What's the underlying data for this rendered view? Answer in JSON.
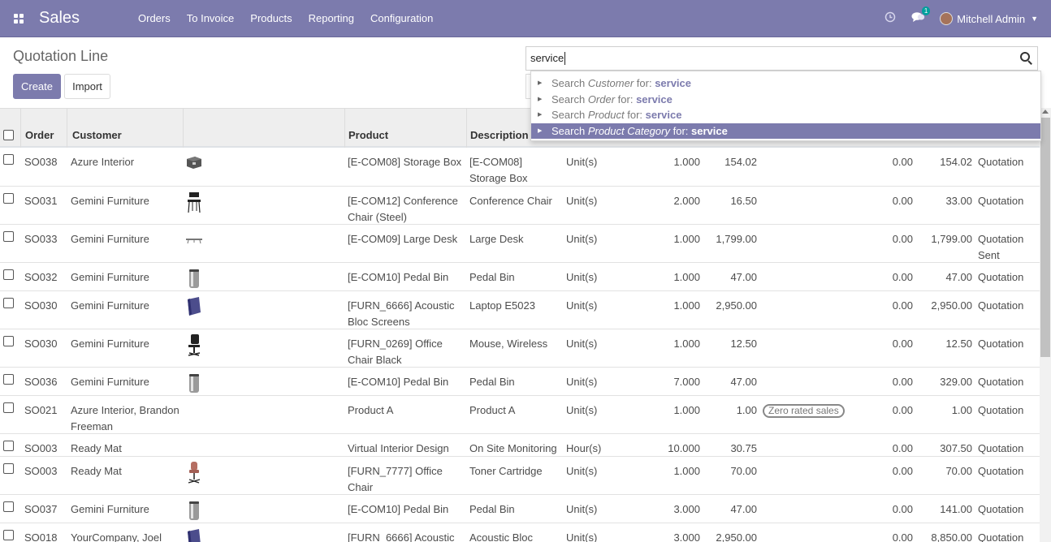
{
  "navbar": {
    "app_name": "Sales",
    "menu": [
      "Orders",
      "To Invoice",
      "Products",
      "Reporting",
      "Configuration"
    ],
    "messages_count": "1",
    "user_name": "Mitchell Admin",
    "colors": {
      "primary": "#7c7bad"
    }
  },
  "control_panel": {
    "title": "Quotation Line",
    "create_label": "Create",
    "import_label": "Import",
    "search_value": "service"
  },
  "autocomplete": [
    {
      "prefix": "Search ",
      "field": "Customer",
      "mid": " for: ",
      "term": "service"
    },
    {
      "prefix": "Search ",
      "field": "Order",
      "mid": " for: ",
      "term": "service"
    },
    {
      "prefix": "Search ",
      "field": "Product",
      "mid": " for: ",
      "term": "service"
    },
    {
      "prefix": "Search ",
      "field": "Product Category",
      "mid": " for: ",
      "term": "service"
    }
  ],
  "table": {
    "headers": {
      "order": "Order",
      "customer": "Customer",
      "product": "Product",
      "description": "Description"
    },
    "rows": [
      {
        "order": "SO038",
        "customer": "Azure Interior",
        "product": "[E-COM08] Storage Box",
        "description": "[E-COM08] Storage Box",
        "uom": "Unit(s)",
        "qty": "1.000",
        "price": "154.02",
        "tax": "",
        "disc": "0.00",
        "subtotal": "154.02",
        "status": "Quotation",
        "image": "box"
      },
      {
        "order": "SO031",
        "customer": "Gemini Furniture",
        "product": "[E-COM12] Conference Chair (Steel)",
        "description": "Conference Chair",
        "uom": "Unit(s)",
        "qty": "2.000",
        "price": "16.50",
        "tax": "",
        "disc": "0.00",
        "subtotal": "33.00",
        "status": "Quotation",
        "image": "chair-steel"
      },
      {
        "order": "SO033",
        "customer": "Gemini Furniture",
        "product": "[E-COM09] Large Desk",
        "description": "Large Desk",
        "uom": "Unit(s)",
        "qty": "1.000",
        "price": "1,799.00",
        "tax": "",
        "disc": "0.00",
        "subtotal": "1,799.00",
        "status": "Quotation Sent",
        "image": "desk"
      },
      {
        "order": "SO032",
        "customer": "Gemini Furniture",
        "product": "[E-COM10] Pedal Bin",
        "description": "Pedal Bin",
        "uom": "Unit(s)",
        "qty": "1.000",
        "price": "47.00",
        "tax": "",
        "disc": "0.00",
        "subtotal": "47.00",
        "status": "Quotation",
        "image": "bin"
      },
      {
        "order": "SO030",
        "customer": "Gemini Furniture",
        "product": "[FURN_6666] Acoustic Bloc Screens",
        "description": "Laptop E5023",
        "uom": "Unit(s)",
        "qty": "1.000",
        "price": "2,950.00",
        "tax": "",
        "disc": "0.00",
        "subtotal": "2,950.00",
        "status": "Quotation",
        "image": "screen"
      },
      {
        "order": "SO030",
        "customer": "Gemini Furniture",
        "product": "[FURN_0269] Office Chair Black",
        "description": "Mouse, Wireless",
        "uom": "Unit(s)",
        "qty": "1.000",
        "price": "12.50",
        "tax": "",
        "disc": "0.00",
        "subtotal": "12.50",
        "status": "Quotation",
        "image": "chair-black"
      },
      {
        "order": "SO036",
        "customer": "Gemini Furniture",
        "product": "[E-COM10] Pedal Bin",
        "description": "Pedal Bin",
        "uom": "Unit(s)",
        "qty": "7.000",
        "price": "47.00",
        "tax": "",
        "disc": "0.00",
        "subtotal": "329.00",
        "status": "Quotation",
        "image": "bin"
      },
      {
        "order": "SO021",
        "customer": "Azure Interior, Brandon Freeman",
        "product": "Product A",
        "description": "Product A",
        "uom": "Unit(s)",
        "qty": "1.000",
        "price": "1.00",
        "tax": "Zero rated sales",
        "disc": "0.00",
        "subtotal": "1.00",
        "status": "Quotation",
        "image": ""
      },
      {
        "order": "SO003",
        "customer": "Ready Mat",
        "product": "Virtual Interior Design",
        "description": "On Site Monitoring",
        "uom": "Hour(s)",
        "qty": "10.000",
        "price": "30.75",
        "tax": "",
        "disc": "0.00",
        "subtotal": "307.50",
        "status": "Quotation",
        "image": ""
      },
      {
        "order": "SO003",
        "customer": "Ready Mat",
        "product": "[FURN_7777] Office Chair",
        "description": "Toner Cartridge",
        "uom": "Unit(s)",
        "qty": "1.000",
        "price": "70.00",
        "tax": "",
        "disc": "0.00",
        "subtotal": "70.00",
        "status": "Quotation",
        "image": "chair-pink"
      },
      {
        "order": "SO037",
        "customer": "Gemini Furniture",
        "product": "[E-COM10] Pedal Bin",
        "description": "Pedal Bin",
        "uom": "Unit(s)",
        "qty": "3.000",
        "price": "47.00",
        "tax": "",
        "disc": "0.00",
        "subtotal": "141.00",
        "status": "Quotation",
        "image": "bin"
      },
      {
        "order": "SO018",
        "customer": "YourCompany, Joel",
        "product": "[FURN_6666] Acoustic",
        "description": "Acoustic Bloc",
        "uom": "Unit(s)",
        "qty": "3.000",
        "price": "2,950.00",
        "tax": "",
        "disc": "0.00",
        "subtotal": "8,850.00",
        "status": "Quotation",
        "image": "screen"
      }
    ]
  }
}
